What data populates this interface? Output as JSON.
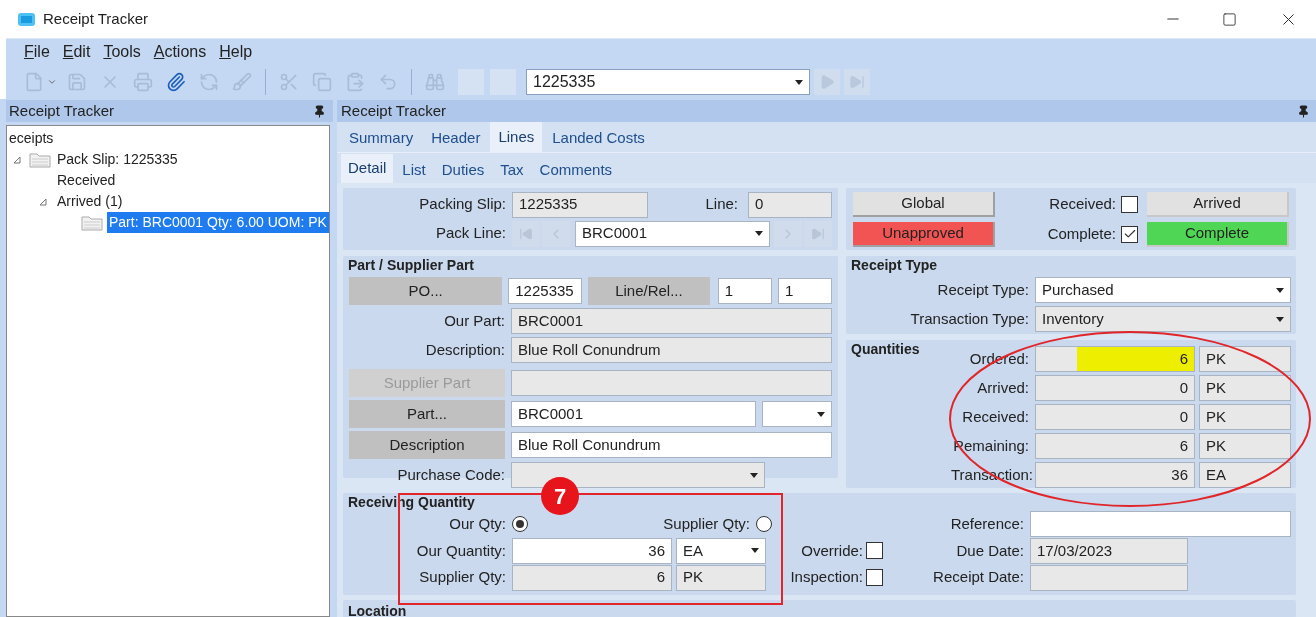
{
  "window": {
    "title": "Receipt Tracker"
  },
  "menu": [
    {
      "label": "File"
    },
    {
      "label": "Edit"
    },
    {
      "label": "Tools"
    },
    {
      "label": "Actions"
    },
    {
      "label": "Help"
    }
  ],
  "toolbar": {
    "buttons": [
      {
        "kind": "new",
        "disabled": true
      },
      {
        "kind": "save",
        "disabled": true
      },
      {
        "kind": "delete",
        "disabled": true
      },
      {
        "kind": "print",
        "disabled": true
      },
      {
        "kind": "attach",
        "disabled": false
      },
      {
        "kind": "refresh",
        "disabled": true
      },
      {
        "kind": "clear",
        "disabled": true
      },
      {
        "kind": "cut",
        "disabled": true
      },
      {
        "kind": "copy",
        "disabled": true
      },
      {
        "kind": "paste",
        "disabled": true
      },
      {
        "kind": "undo",
        "disabled": true
      },
      {
        "kind": "search",
        "disabled": true
      },
      {
        "kind": "blank",
        "disabled": true
      },
      {
        "kind": "blank",
        "disabled": true
      }
    ],
    "lookup": {
      "value": "1225335"
    },
    "nav": [
      {
        "kind": "next",
        "disabled": true
      },
      {
        "kind": "last",
        "disabled": true
      }
    ]
  },
  "tree_panel": {
    "title": "Receipt Tracker",
    "tree": [
      {
        "label": "eceipts",
        "selected": false,
        "children": [
          {
            "label": "Pack Slip: 1225335",
            "selected": false,
            "expanded": true,
            "children": [
              {
                "label": "Received",
                "selected": false
              },
              {
                "label": "Arrived (1)",
                "selected": false,
                "expanded": true,
                "children": [
                  {
                    "label": "Part: BRC0001 Qty: 6.00 UOM: PK",
                    "selected": true
                  }
                ]
              }
            ]
          }
        ]
      }
    ]
  },
  "main": {
    "title": "Receipt Tracker",
    "tabs": [
      {
        "label": "Summary",
        "selected": false
      },
      {
        "label": "Header",
        "selected": false
      },
      {
        "label": "Lines",
        "selected": true
      },
      {
        "label": "Landed Costs",
        "selected": false
      }
    ],
    "subtabs": [
      {
        "label": "Detail",
        "selected": true
      },
      {
        "label": "List",
        "selected": false
      },
      {
        "label": "Duties",
        "selected": false
      },
      {
        "label": "Tax",
        "selected": false
      },
      {
        "label": "Comments",
        "selected": false
      }
    ],
    "pack": {
      "packing_slip": {
        "label": "Packing Slip:",
        "value": "1225335",
        "editable": false
      },
      "line": {
        "label": "Line:",
        "value": "0",
        "editable": false
      },
      "pack_line": {
        "label": "Pack Line:",
        "value": "BRC0001",
        "editable": true
      }
    },
    "part_group": {
      "title": "Part / Supplier Part",
      "po": {
        "button": "PO...",
        "value": "1225335",
        "editable": true
      },
      "line_rel": {
        "button": "Line/Rel...",
        "values": [
          {
            "value": "1",
            "editable": true
          },
          {
            "value": "1",
            "editable": true
          }
        ]
      },
      "our_part": {
        "label": "Our Part:",
        "value": "BRC0001",
        "editable": false
      },
      "description": {
        "label": "Description:",
        "value": "Blue Roll Conundrum",
        "editable": false
      },
      "supplier_part": {
        "button": "Supplier Part",
        "disabled": true,
        "editable": false
      },
      "part": {
        "button": "Part...",
        "disabled": false,
        "value": "BRC0001",
        "editable": true
      },
      "part_description": {
        "button": "Description",
        "disabled": false,
        "value": "Blue Roll Conundrum",
        "editable": true
      },
      "purchase_code": {
        "label": "Purchase Code:",
        "editable": false
      }
    },
    "status": {
      "rows": [
        {
          "button": {
            "label": "Global",
            "color": "#e1e1e1"
          },
          "check": {
            "label": "Received:",
            "checked": false
          },
          "state": {
            "label": "Arrived",
            "color": "#e1e1e1"
          }
        },
        {
          "button": {
            "label": "Unapproved",
            "color": "#f25353"
          },
          "check": {
            "label": "Complete:",
            "checked": true
          },
          "state": {
            "label": "Complete",
            "color": "#4fd655"
          }
        }
      ]
    },
    "receipt_type": {
      "title": "Receipt Type",
      "fields": [
        {
          "label": "Receipt Type:",
          "value": "Purchased",
          "editable": true
        },
        {
          "label": "Transaction Type:",
          "value": "Inventory",
          "editable": false
        }
      ]
    },
    "quantities": {
      "title": "Quantities",
      "rows": [
        {
          "label": "Ordered:",
          "value": "6",
          "unit": "PK",
          "highlighted": true
        },
        {
          "label": "Arrived:",
          "value": "0",
          "unit": "PK",
          "highlighted": false
        },
        {
          "label": "Received:",
          "value": "0",
          "unit": "PK",
          "highlighted": false
        },
        {
          "label": "Remaining:",
          "value": "6",
          "unit": "PK",
          "highlighted": false
        },
        {
          "label": "Transaction:",
          "value": "36",
          "unit": "EA",
          "highlighted": false
        }
      ]
    },
    "receiving": {
      "title": "Receiving Quantity",
      "modes": [
        {
          "label": "Our Qty:",
          "selected": true
        },
        {
          "label": "Supplier Qty:",
          "selected": false
        }
      ],
      "our_quantity": {
        "label": "Our Quantity:",
        "value": "36",
        "unit": "EA",
        "editable": true
      },
      "supplier_qty": {
        "label": "Supplier Qty:",
        "value": "6",
        "unit": "PK",
        "editable": false
      },
      "flags": [
        {
          "label": "Override:",
          "checked": false
        },
        {
          "label": "Inspection:",
          "checked": false
        }
      ],
      "reference": {
        "label": "Reference:",
        "editable": true
      },
      "due_date": {
        "label": "Due Date:",
        "value": "17/03/2023",
        "editable": false
      },
      "receipt_date": {
        "label": "Receipt Date:",
        "editable": false
      }
    },
    "location": {
      "title": "Location"
    }
  },
  "annotation": {
    "badge": "7"
  }
}
